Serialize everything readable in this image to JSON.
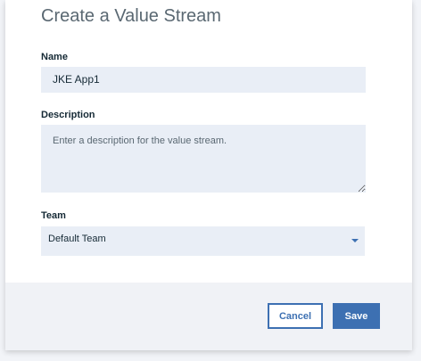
{
  "dialog": {
    "title": "Create a Value Stream"
  },
  "form": {
    "name": {
      "label": "Name",
      "value": "JKE App1"
    },
    "description": {
      "label": "Description",
      "placeholder": "Enter a description for the value stream.",
      "value": ""
    },
    "team": {
      "label": "Team",
      "selected": "Default Team"
    }
  },
  "footer": {
    "cancel_label": "Cancel",
    "save_label": "Save"
  },
  "icons": {
    "select_arrow": "chevron-down-icon",
    "resize": "resize-handle-icon"
  },
  "colors": {
    "accent": "#3d70b2",
    "field_bg": "#e9eef6",
    "footer_bg": "#f0f2f6"
  }
}
